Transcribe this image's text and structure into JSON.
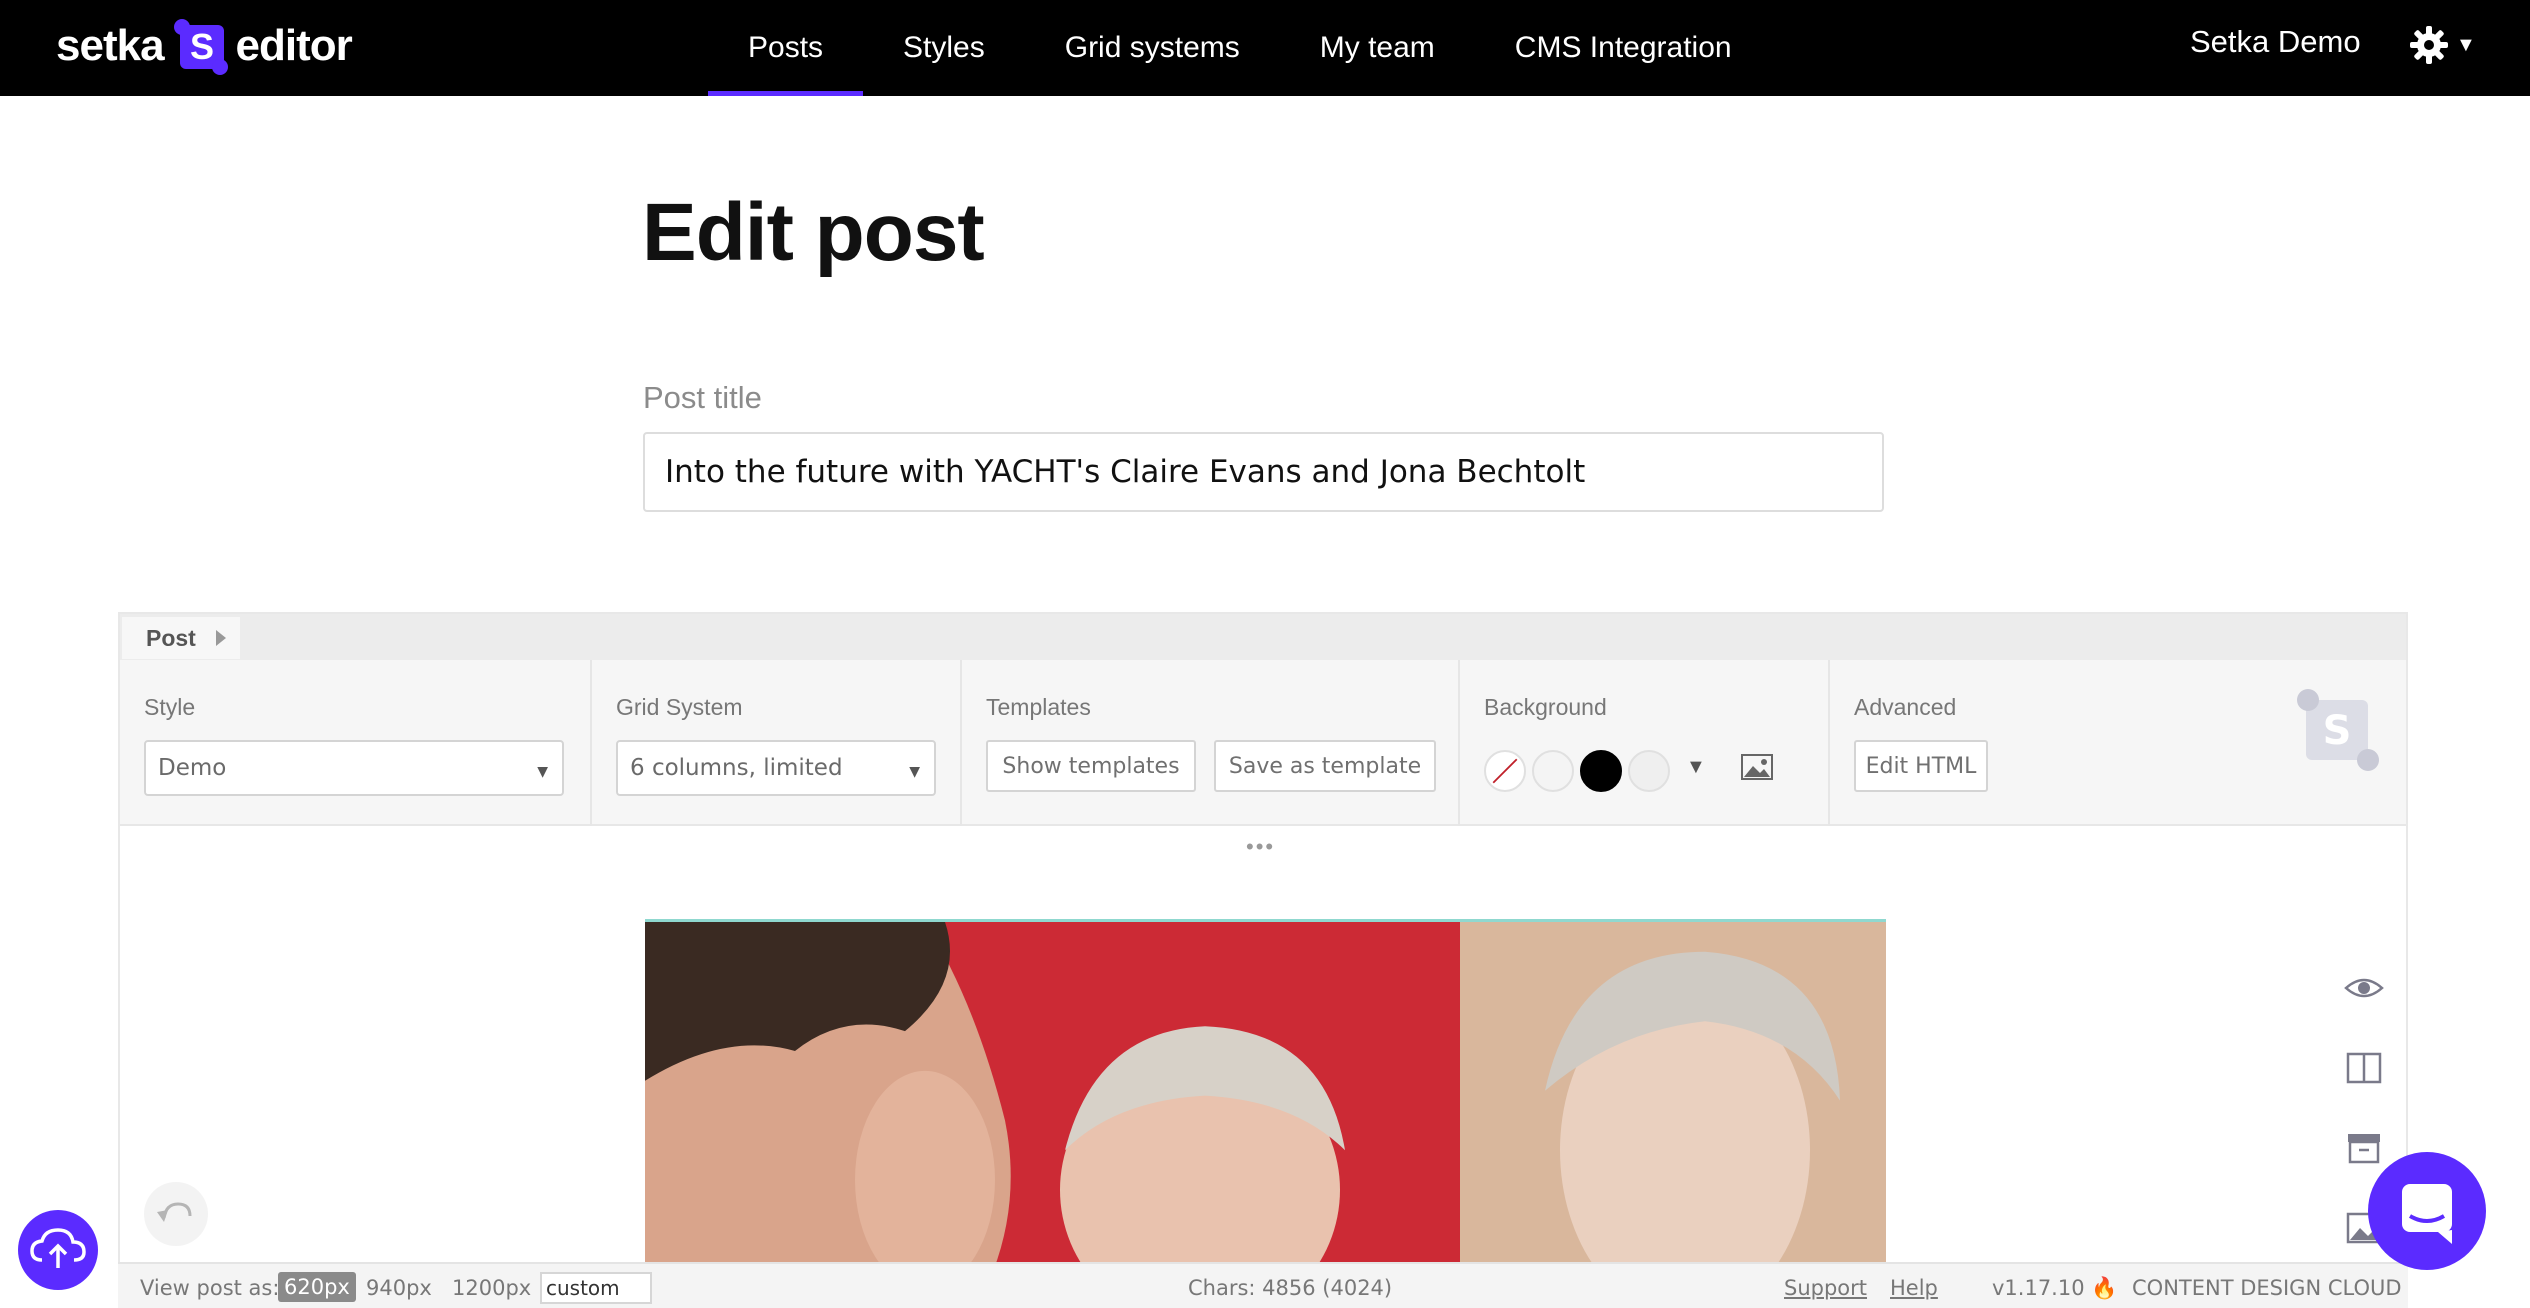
{
  "nav": {
    "logo_left": "setka",
    "logo_mark": "S",
    "logo_right": "editor",
    "links": [
      {
        "label": "Posts",
        "active": true
      },
      {
        "label": "Styles",
        "active": false
      },
      {
        "label": "Grid systems",
        "active": false
      },
      {
        "label": "My team",
        "active": false
      },
      {
        "label": "CMS Integration",
        "active": false
      }
    ],
    "user_name": "Setka Demo",
    "settings_icon": "gear-icon"
  },
  "page": {
    "heading": "Edit post",
    "post_title_label": "Post title",
    "post_title_value": "Into the future with YACHT's Claire Evans and Jona Bechtolt"
  },
  "editor": {
    "breadcrumb": "Post",
    "style": {
      "label": "Style",
      "value": "Demo"
    },
    "grid": {
      "label": "Grid System",
      "value": "6 columns, limited"
    },
    "templates": {
      "label": "Templates",
      "show": "Show templates",
      "save": "Save as template"
    },
    "background": {
      "label": "Background",
      "swatches": [
        "none",
        "#f4f4f4",
        "#000000",
        "#efefef"
      ]
    },
    "advanced": {
      "label": "Advanced",
      "edit_html": "Edit HTML"
    },
    "handle": "•••"
  },
  "status": {
    "view_as_label": "View post as:",
    "viewports": [
      "620px",
      "940px",
      "1200px"
    ],
    "active_viewport": "620px",
    "custom_value": "custom",
    "chars": "Chars: 4856 (4024)",
    "support": "Support",
    "help": "Help",
    "version": "v1.17.10 🔥",
    "brand": "CONTENT DESIGN CLOUD"
  },
  "colors": {
    "accent": "#5b2bff",
    "nav_bg": "#000000",
    "photo_red": "#cc2a35",
    "photo_tan": "#d9b79c"
  }
}
